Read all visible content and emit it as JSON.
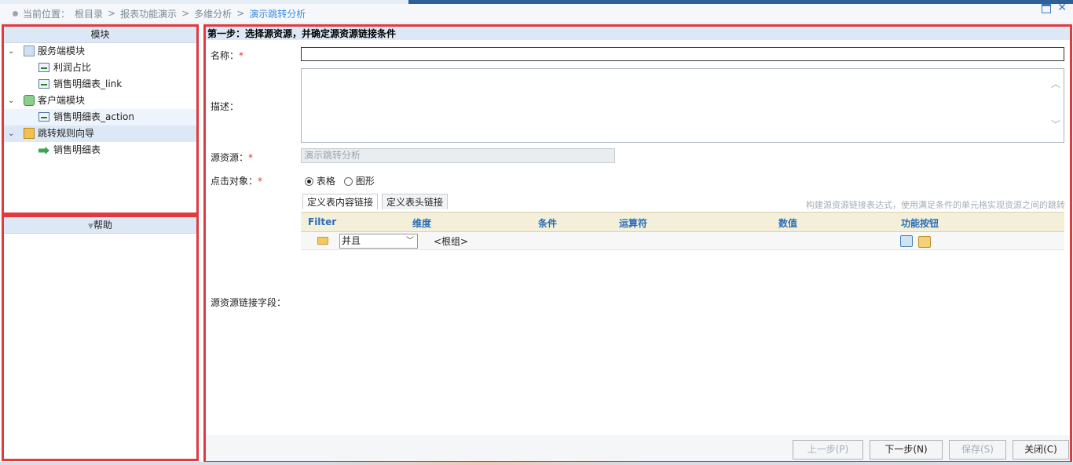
{
  "breadcrumb": {
    "prefix": "当前位置：",
    "items": [
      "根目录",
      ">",
      "报表功能演示",
      ">",
      "多维分析",
      ">"
    ],
    "current": "演示跳转分析"
  },
  "left": {
    "module_header": "模块",
    "tree": [
      {
        "label": "服务端模块",
        "icon": "server-module-icon"
      },
      {
        "label": "利润占比",
        "icon": "report-icon"
      },
      {
        "label": "销售明细表_link",
        "icon": "report-icon"
      },
      {
        "label": "客户端模块",
        "icon": "client-module-icon"
      },
      {
        "label": "销售明细表_action",
        "icon": "report-icon"
      },
      {
        "label": "跳转规则向导",
        "icon": "wizard-icon"
      },
      {
        "label": "销售明细表",
        "icon": "jump-icon"
      }
    ],
    "help_header": "帮助"
  },
  "form": {
    "step_title": "第一步：选择源资源，并确定源资源链接条件",
    "name_label": "名称：",
    "name_value": "",
    "desc_label": "描述：",
    "src_label": "源资源：",
    "src_value": "演示跳转分析",
    "click_label": "点击对象：",
    "radio_table": "表格",
    "radio_chart": "图形",
    "tab_content": "定义表内容链接",
    "tab_header": "定义表头链接",
    "hint": "构建源资源链接表达式，使用满足条件的单元格实现资源之间的跳转",
    "link_field_label": "源资源链接字段：",
    "required_mark": "*"
  },
  "grid": {
    "columns": [
      "Filter",
      "维度",
      "条件",
      "运算符",
      "数值",
      "功能按钮"
    ],
    "row": {
      "select_value": "并且",
      "group_label": "<根组>"
    }
  },
  "buttons": {
    "prev": "上一步(P)",
    "next": "下一步(N)",
    "save": "保存(S)",
    "close": "关闭(C)"
  }
}
